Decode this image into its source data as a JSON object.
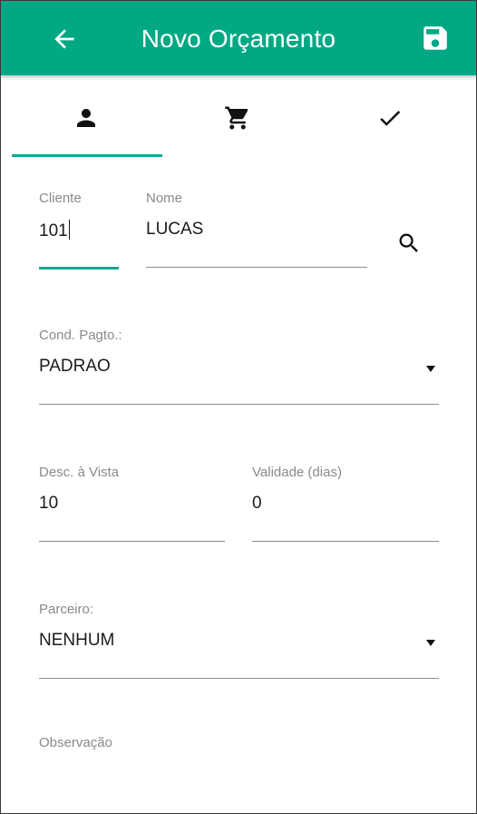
{
  "appbar": {
    "title": "Novo Orçamento",
    "back_icon": "arrow-left-icon",
    "save_icon": "floppy-save-icon",
    "color": "#00a884"
  },
  "tabs": [
    {
      "icon": "person-icon",
      "selected": true
    },
    {
      "icon": "shopping-cart-icon",
      "selected": false
    },
    {
      "icon": "checkmark-icon",
      "selected": false
    }
  ],
  "accent_color": "#1aa591",
  "form": {
    "cliente": {
      "label": "Cliente",
      "value": "101"
    },
    "nome": {
      "label": "Nome",
      "value": "LUCAS"
    },
    "search_icon": "search-icon",
    "cond_pagto": {
      "label": "Cond. Pagto.:",
      "value": "PADRAO"
    },
    "desc_vista": {
      "label": "Desc. à Vista",
      "value": "10"
    },
    "validade": {
      "label": "Validade (dias)",
      "value": "0"
    },
    "parceiro": {
      "label": "Parceiro:",
      "value": "NENHUM"
    },
    "observacao": {
      "label": "Observação",
      "value": ""
    }
  }
}
